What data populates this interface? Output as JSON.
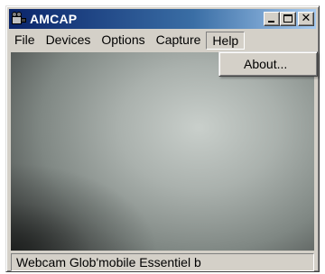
{
  "window": {
    "title": "AMCAP",
    "icon": "webcam-app-icon",
    "controls": {
      "minimize": "minimize-icon",
      "maximize": "maximize-icon",
      "close": "close-icon"
    }
  },
  "menubar": {
    "items": [
      {
        "label": "File"
      },
      {
        "label": "Devices"
      },
      {
        "label": "Options"
      },
      {
        "label": "Capture"
      },
      {
        "label": "Help",
        "open": true
      }
    ]
  },
  "help_menu": {
    "items": [
      {
        "label": "About..."
      }
    ]
  },
  "status": {
    "text": "Webcam Glob'mobile Essentiel b"
  },
  "colors": {
    "titlebar_start": "#0a246a",
    "titlebar_end": "#a6caf0",
    "window_face": "#d4d0c8"
  }
}
